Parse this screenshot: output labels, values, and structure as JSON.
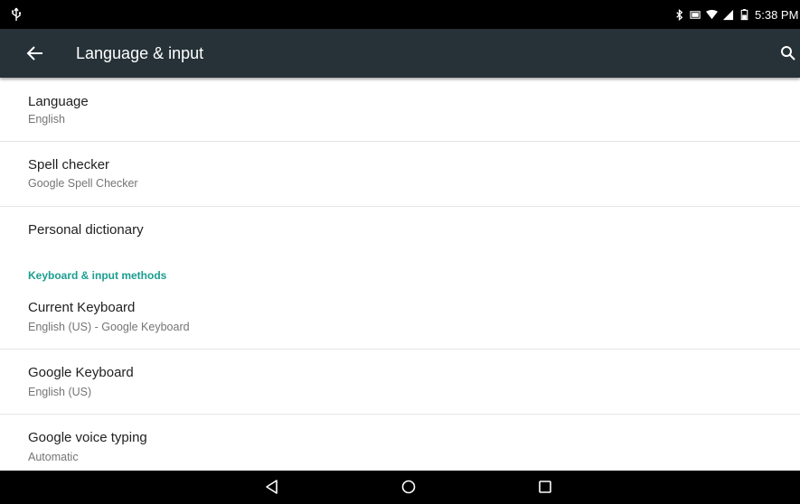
{
  "status_bar": {
    "time": "5:38 PM",
    "usb_icon": "usb-icon",
    "bluetooth_icon": "bluetooth-icon",
    "battery_icon": "battery-icon",
    "wifi_icon": "wifi-icon",
    "signal_icon": "signal-icon"
  },
  "action_bar": {
    "title": "Language & input",
    "back_icon": "arrow-back-icon",
    "search_icon": "search-icon",
    "background": "#263238"
  },
  "items": [
    {
      "title": "Language",
      "summary": "English"
    },
    {
      "title": "Spell checker",
      "summary": "Google Spell Checker"
    },
    {
      "title": "Personal dictionary",
      "summary": ""
    }
  ],
  "category": {
    "label": "Keyboard & input methods",
    "color": "#1a9e8f"
  },
  "keyboard_items": [
    {
      "title": "Current Keyboard",
      "summary": "English (US) - Google Keyboard"
    },
    {
      "title": "Google Keyboard",
      "summary": "English (US)"
    },
    {
      "title": "Google voice typing",
      "summary": "Automatic"
    }
  ],
  "nav_bar": {
    "back_icon": "nav-back-icon",
    "home_icon": "nav-home-icon",
    "recents_icon": "nav-recents-icon"
  }
}
